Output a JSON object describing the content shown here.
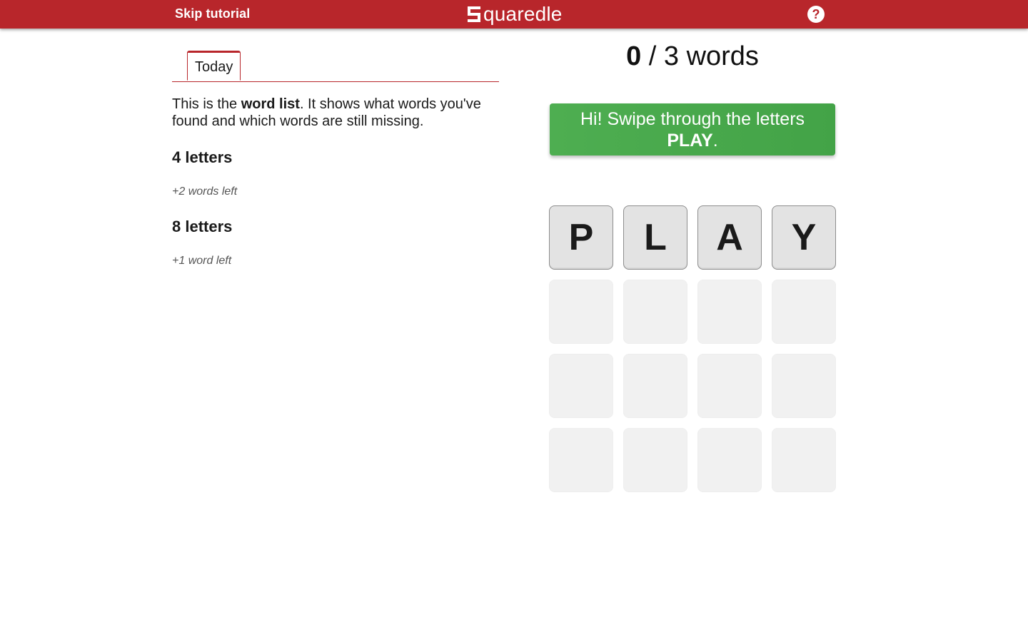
{
  "header": {
    "skip_label": "Skip tutorial",
    "logo_text": "quaredle",
    "help_icon": "?"
  },
  "tabs": [
    {
      "label": "Today"
    }
  ],
  "word_list": {
    "desc_prefix": "This is the ",
    "desc_bold": "word list",
    "desc_suffix": ". It shows what words you've found and which words are still missing.",
    "sections": [
      {
        "heading": "4 letters",
        "left": "+2 words left"
      },
      {
        "heading": "8 letters",
        "left": "+1 word left"
      }
    ]
  },
  "counter": {
    "found": "0",
    "rest": " / 3 words"
  },
  "banner": {
    "line1": "Hi! Swipe through the letters",
    "word": "PLAY",
    "end": "."
  },
  "board": {
    "letters": [
      "P",
      "L",
      "A",
      "Y"
    ]
  },
  "colors": {
    "header_bg": "#b8262b",
    "banner_bg": "#4caf50",
    "tile_bg": "#e3e3e3",
    "empty_tile_bg": "#f1f1f1"
  }
}
